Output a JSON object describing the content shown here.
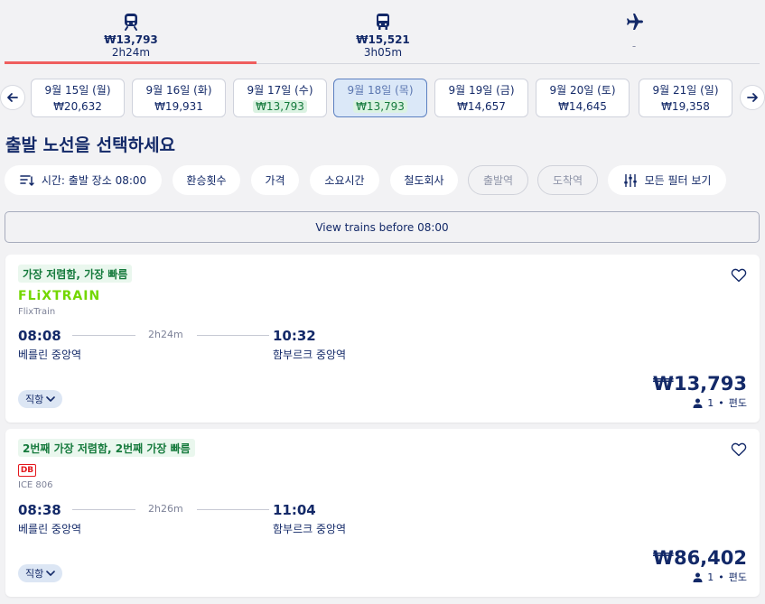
{
  "modes": [
    {
      "icon": "train-icon",
      "price": "₩13,793",
      "duration": "2h24m"
    },
    {
      "icon": "bus-icon",
      "price": "₩15,521",
      "duration": "3h05m"
    },
    {
      "icon": "plane-icon",
      "price": "",
      "duration": "-"
    }
  ],
  "dates": [
    {
      "date": "9월 15일 (월)",
      "price": "₩20,632"
    },
    {
      "date": "9월 16일 (화)",
      "price": "₩19,931"
    },
    {
      "date": "9월 17일 (수)",
      "price": "₩13,793"
    },
    {
      "date": "9월 18일 (목)",
      "price": "₩13,793"
    },
    {
      "date": "9월 19일 (금)",
      "price": "₩14,657"
    },
    {
      "date": "9월 20일 (토)",
      "price": "₩14,645"
    },
    {
      "date": "9월 21일 (일)",
      "price": "₩19,358"
    }
  ],
  "page_title": "출발 노선을 선택하세요",
  "filters": {
    "sort": "시간: 출발 장소 08:00",
    "transfers": "환승횟수",
    "price": "가격",
    "duration": "소요시간",
    "operator": "철도회사",
    "departure_station": "출발역",
    "arrival_station": "도착역",
    "all_filters": "모든 필터 보기"
  },
  "view_before": "View trains before 08:00",
  "results": [
    {
      "badge": "가장 저렴함, 가장 빠름",
      "logo": "FLiXTRAIN",
      "operator": "FlixTrain",
      "depart_time": "08:08",
      "arrive_time": "10:32",
      "duration": "2h24m",
      "from": "베를린 중앙역",
      "to": "함부르크 중앙역",
      "direct": "직항",
      "price": "₩13,793",
      "passengers": "1",
      "trip_type": "편도"
    },
    {
      "badge": "2번째 가장 저렴함, 2번째 가장 빠름",
      "logo": "DB",
      "operator": "ICE 806",
      "depart_time": "08:38",
      "arrive_time": "11:04",
      "duration": "2h26m",
      "from": "베를린 중앙역",
      "to": "함부르크 중앙역",
      "direct": "직항",
      "price": "₩86,402",
      "passengers": "1",
      "trip_type": "편도"
    }
  ],
  "colors": {
    "accent": "#ef5e5e",
    "navy": "#132968",
    "green": "#157a3c",
    "flix": "#73d700",
    "db": "#e4161b"
  }
}
